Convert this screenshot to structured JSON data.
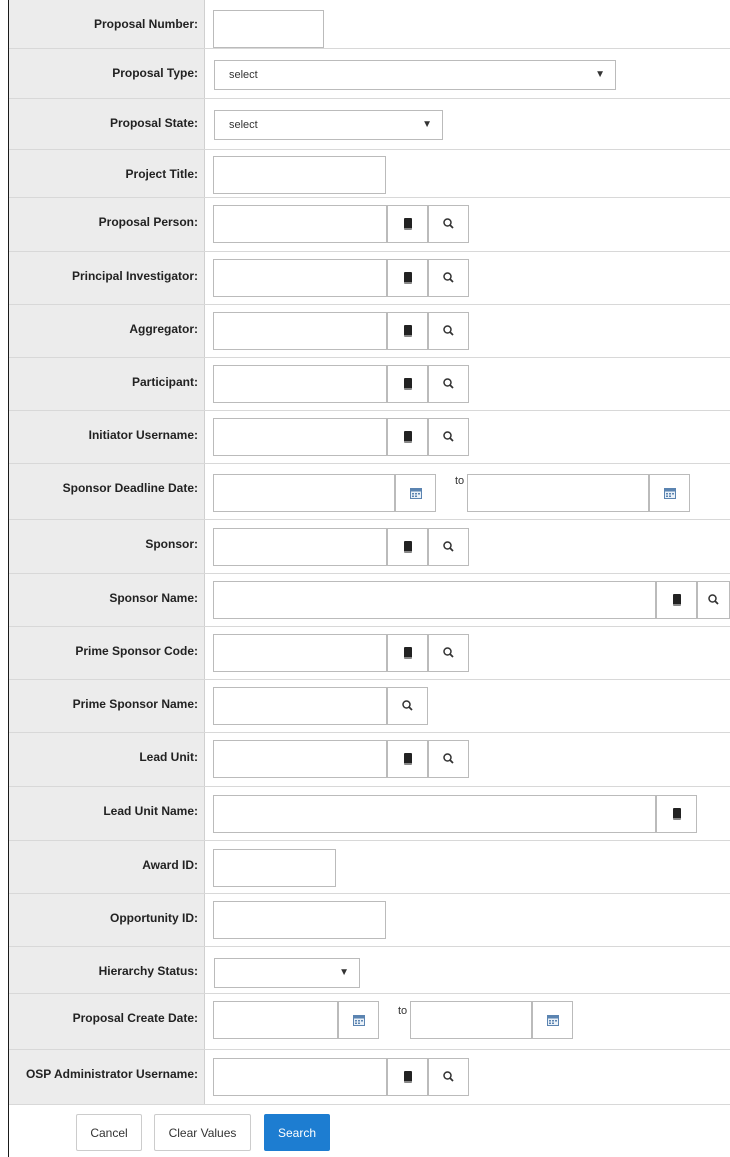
{
  "fields": {
    "proposal_number": {
      "label": "Proposal Number:",
      "value": ""
    },
    "proposal_type": {
      "label": "Proposal Type:",
      "selected": "select"
    },
    "proposal_state": {
      "label": "Proposal State:",
      "selected": "select"
    },
    "project_title": {
      "label": "Project Title:",
      "value": ""
    },
    "proposal_person": {
      "label": "Proposal Person:",
      "value": ""
    },
    "principal_investigator": {
      "label": "Principal Investigator:",
      "value": ""
    },
    "aggregator": {
      "label": "Aggregator:",
      "value": ""
    },
    "participant": {
      "label": "Participant:",
      "value": ""
    },
    "initiator_username": {
      "label": "Initiator Username:",
      "value": ""
    },
    "sponsor_deadline_date": {
      "label": "Sponsor Deadline Date:",
      "from": "",
      "to_label": "to",
      "to": ""
    },
    "sponsor": {
      "label": "Sponsor:",
      "value": ""
    },
    "sponsor_name": {
      "label": "Sponsor Name:",
      "value": ""
    },
    "prime_sponsor_code": {
      "label": "Prime Sponsor Code:",
      "value": ""
    },
    "prime_sponsor_name": {
      "label": "Prime Sponsor Name:",
      "value": ""
    },
    "lead_unit": {
      "label": "Lead Unit:",
      "value": ""
    },
    "lead_unit_name": {
      "label": "Lead Unit Name:",
      "value": ""
    },
    "award_id": {
      "label": "Award ID:",
      "value": ""
    },
    "opportunity_id": {
      "label": "Opportunity ID:",
      "value": ""
    },
    "hierarchy_status": {
      "label": "Hierarchy Status:",
      "selected": ""
    },
    "proposal_create_date": {
      "label": "Proposal Create Date:",
      "from": "",
      "to_label": "to",
      "to": ""
    },
    "osp_admin_username": {
      "label": "OSP Administrator Username:",
      "value": ""
    }
  },
  "buttons": {
    "cancel": "Cancel",
    "clear": "Clear Values",
    "search": "Search"
  },
  "icons": {
    "directory": "book-icon",
    "lookup": "search-icon",
    "date": "calendar-icon"
  },
  "colors": {
    "label_bg": "#ececec",
    "primary": "#1d7dd1"
  }
}
